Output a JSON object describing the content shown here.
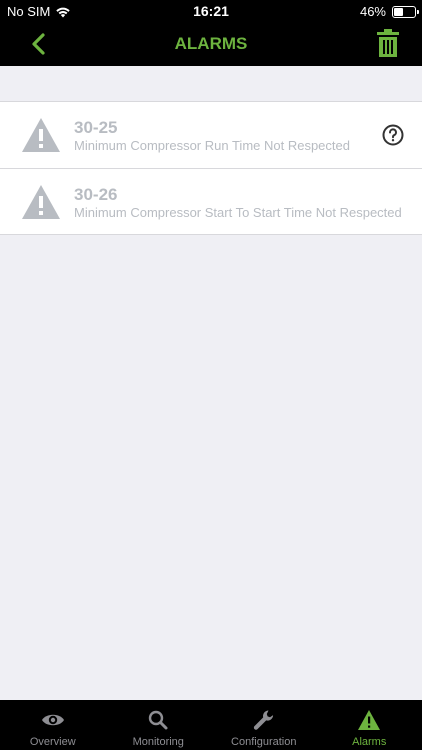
{
  "status_bar": {
    "carrier": "No SIM",
    "time": "16:21",
    "battery": "46%",
    "battery_level": 0.46
  },
  "nav": {
    "title": "ALARMS",
    "back_icon": "chevron-left-icon",
    "action_icon": "trash-icon"
  },
  "alarms": [
    {
      "code": "30-25",
      "description": "Minimum Compressor Run Time Not Respected",
      "has_help": true
    },
    {
      "code": "30-26",
      "description": "Minimum Compressor Start To Start Time Not Respected",
      "has_help": false
    }
  ],
  "tabs": [
    {
      "label": "Overview",
      "icon": "eye-icon",
      "active": false
    },
    {
      "label": "Monitoring",
      "icon": "magnifier-icon",
      "active": false
    },
    {
      "label": "Configuration",
      "icon": "wrench-icon",
      "active": false
    },
    {
      "label": "Alarms",
      "icon": "warning-icon",
      "active": true
    }
  ],
  "colors": {
    "accent": "#6db33f",
    "inactive": "#8e8e93",
    "alarm_text": "#b8bcc2",
    "background": "#efeff4"
  }
}
